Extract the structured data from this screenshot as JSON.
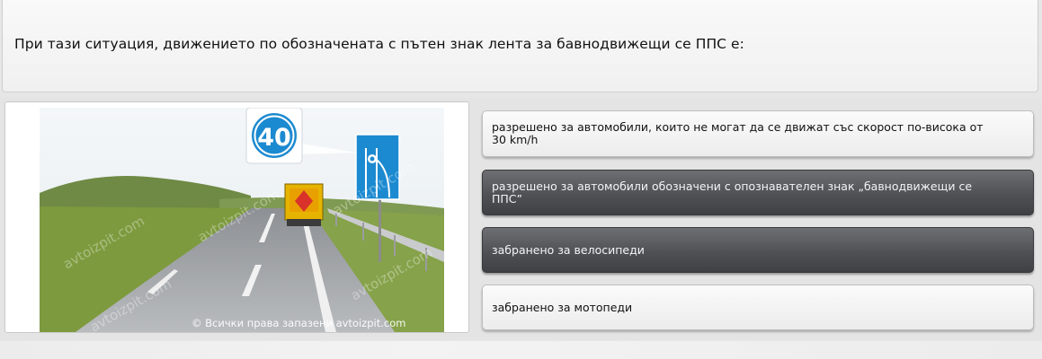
{
  "question": {
    "text": "При тази ситуация, движението по обозначената с пътен знак лента за бавнодвижещи се ППС е:"
  },
  "image": {
    "speed_sign_value": "40",
    "copyright": "© Всички права запазени avtoizpit.com",
    "watermark": "avtoizpit.com"
  },
  "answers": [
    {
      "label": "разрешено за автомобили, които не могат да се движат със скорост по-висока от 30 km/h",
      "style": "light"
    },
    {
      "label": "разрешено за автомобили обозначени с опознавателен знак „бавнодвижещи се ППС”",
      "style": "dark"
    },
    {
      "label": "забранено за велосипеди",
      "style": "dark"
    },
    {
      "label": "забранено за мотопеди",
      "style": "light"
    }
  ],
  "colors": {
    "dark_answer": "#505155",
    "light_answer": "#f4f4f4",
    "sign_blue": "#1c8ad0"
  }
}
